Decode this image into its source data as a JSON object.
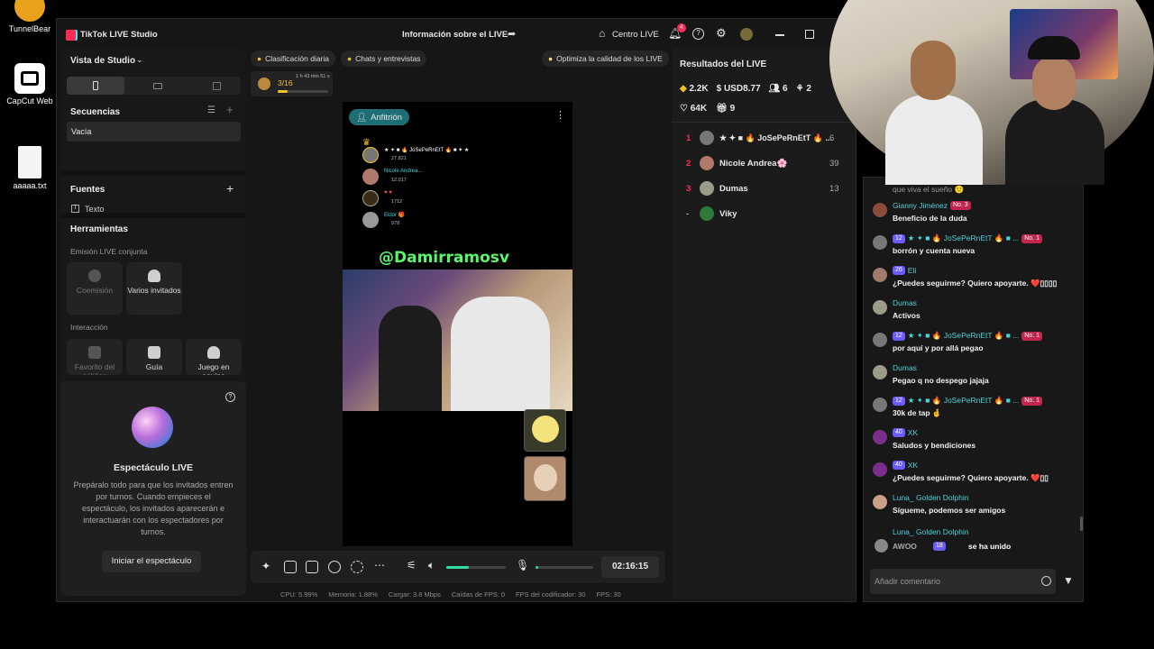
{
  "desktop": {
    "icons": [
      {
        "label": "TunnelBear"
      },
      {
        "label": "CapCut Web"
      },
      {
        "label": "aaaaa.txt"
      }
    ]
  },
  "app": {
    "title": "TikTok LIVE Studio",
    "center_title": "Información sobre el LIVE",
    "centro_live": "Centro LIVE",
    "notif_count": "4"
  },
  "left": {
    "studio_view": "Vista de Studio",
    "sequences_title": "Secuencias",
    "sequence_item": "Vacía",
    "sources_title": "Fuentes",
    "source_item": "Texto",
    "tools_title": "Herramientas",
    "joint_live": "Emisión LIVE conjunta",
    "tile_coemision": "Coemisión",
    "tile_varios": "Varios invitados",
    "interaction": "Interacción",
    "tile_favorito": "Favorito del público",
    "tile_guia": "Guía",
    "tile_juego": "Juego en equipo",
    "show_title": "Espectáculo LIVE",
    "show_desc": "Prepáralo todo para que los invitados entren por turnos. Cuando empieces el espectáculo, los invitados aparecerán e interactuarán con los espectadores por turnos.",
    "show_button": "Iniciar el espectáculo"
  },
  "center": {
    "daily_rank": "Clasificación diaria",
    "chats": "Chats y entrevistas",
    "optimize": "Optimiza la calidad de los LIVE",
    "rank_progress": "3/16",
    "rank_timer": "1 h 43 min 51 s",
    "rank_progress_fraction": 0.19,
    "host_badge": "Anfitrión",
    "handle": "@Damirramosv",
    "leaders": [
      {
        "name": "★ ✦ ■ 🔥 JoSePeRnEtT 🔥 ■ ✦ ★",
        "score": "27.821"
      },
      {
        "name": "Nicole Andrea...",
        "score": "12.017"
      },
      {
        "name": "♥ ♥",
        "score": "1712"
      },
      {
        "name": "Eldor 🎁",
        "score": "978"
      }
    ],
    "timer": "02:16:15",
    "volume_fraction": 0.38,
    "mic_fraction": 0.05
  },
  "status": {
    "cpu": "CPU:  5.99%",
    "memoria": "Memoria:  1.88%",
    "cargar": "Cargar:  3.8 Mbps",
    "caidas": "Caídas de FPS:  0",
    "codificador": "FPS del codificador:  30",
    "fps": "FPS:  30"
  },
  "results": {
    "title": "Resultados del LIVE",
    "diamonds": "2.2K",
    "usd": "USD8.77",
    "viewers": "6",
    "shares": "2",
    "likes": "64K",
    "gifts": "9",
    "ranking": [
      {
        "pos": "1",
        "name": "★ ✦ ■ 🔥 JoSePeRnEtT 🔥 ...",
        "score": "6"
      },
      {
        "pos": "2",
        "name": "Nicole Andrea🌸",
        "score": "39"
      },
      {
        "pos": "3",
        "name": "Dumas",
        "score": "13"
      },
      {
        "pos": "-",
        "name": "Viky",
        "score": ""
      }
    ]
  },
  "chat": {
    "top_partial": "que viva el sueño 🙂",
    "messages": [
      {
        "name": "Gianny Jiménez",
        "badges": [
          "No. 3"
        ],
        "text": "Beneficio de la duda",
        "avatar": "#8a4b3a"
      },
      {
        "name": "★ ✦ ■ 🔥 JoSePeRnEtT 🔥 ■ ...",
        "badges": [
          "12",
          "No. 1"
        ],
        "text": "borrón y cuenta nueva",
        "avatar": "#777"
      },
      {
        "name": "Eli",
        "badges": [
          "26"
        ],
        "text": "¿Puedes seguirme? Quiero apoyarte. ❤️▯▯▯▯",
        "avatar": "#a07a6a"
      },
      {
        "name": "Dumas",
        "badges": [],
        "text": "Activos",
        "avatar": "#9c9c8c"
      },
      {
        "name": "★ ✦ ■ 🔥 JoSePeRnEtT 🔥 ■ ...",
        "badges": [
          "12",
          "No. 1"
        ],
        "text": "por aquí y por allá pegao",
        "avatar": "#777"
      },
      {
        "name": "Dumas",
        "badges": [],
        "text": "Pegao q no despego jajaja",
        "avatar": "#9c9c8c"
      },
      {
        "name": "★ ✦ ■ 🔥 JoSePeRnEtT 🔥 ■ ...",
        "badges": [
          "12",
          "No. 1"
        ],
        "text": "30k de tap 🤞",
        "avatar": "#777"
      },
      {
        "name": "XK",
        "badges": [
          "40"
        ],
        "text": "Saludos y bendiciones",
        "avatar": "#7a2f8c"
      },
      {
        "name": "XK",
        "badges": [
          "40"
        ],
        "text": "¿Puedes seguirme? Quiero apoyarte. ❤️▯▯",
        "avatar": "#7a2f8c"
      },
      {
        "name": "Luna_ Golden Dolphin",
        "badges": [],
        "text": "Sígueme, podemos ser amigos",
        "avatar": "#c9a08a"
      }
    ],
    "partial_bottom": "Luna_ Golden Dolphin",
    "joined_name": "AWOO",
    "joined_badge": "18",
    "joined_text": "se ha unido",
    "input_placeholder": "Añadir comentario"
  }
}
